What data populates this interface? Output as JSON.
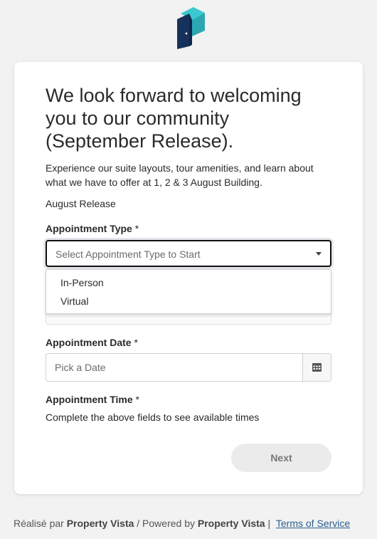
{
  "brand": {
    "logo_icon": "door-cube-logo-icon",
    "colors": {
      "teal": "#2bb5c0",
      "navy": "#16325c"
    }
  },
  "card": {
    "title": "We look forward to welcoming you to our community (September Release).",
    "description": "Experience our suite layouts, tour amenities, and learn about what we have to offer at 1, 2 & 3 August Building.",
    "release_name": "August Release"
  },
  "form": {
    "appointment_type": {
      "label": "Appointment Type",
      "required_mark": "*",
      "placeholder": "Select Appointment Type to Start",
      "options": [
        "In-Person",
        "Virtual"
      ]
    },
    "appointment_date": {
      "label": "Appointment Date",
      "required_mark": "*",
      "placeholder": "Pick a Date",
      "icon": "calendar-icon"
    },
    "appointment_time": {
      "label": "Appointment Time",
      "required_mark": "*",
      "helper": "Complete the above fields to see available times"
    },
    "next_label": "Next"
  },
  "footer": {
    "realise_par": "Réalisé par",
    "brand1": "Property Vista",
    "powered_by": "/ Powered by",
    "brand2": "Property Vista",
    "separator": "|",
    "terms": "Terms of Service"
  }
}
